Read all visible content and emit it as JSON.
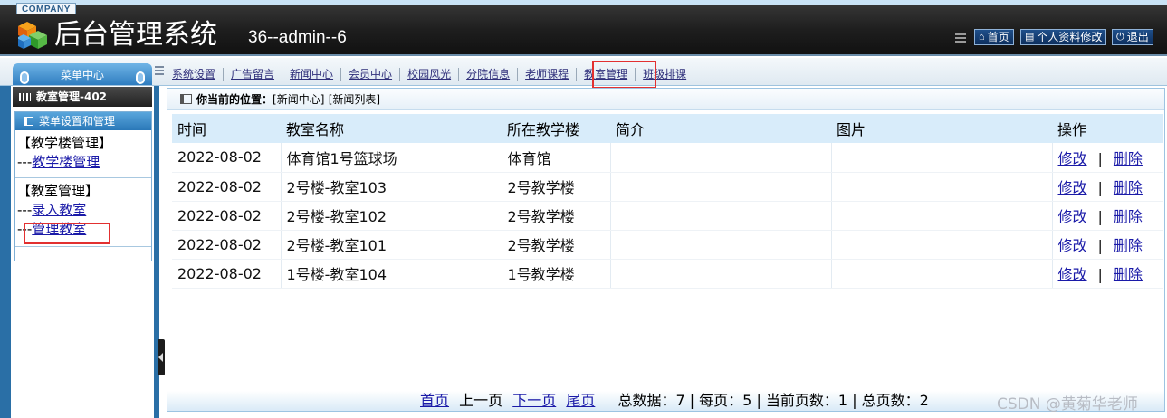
{
  "header": {
    "company": "COMPANY",
    "title": "后台管理系统",
    "user": "36--admin--6",
    "buttons": {
      "home": "首页",
      "profile": "个人资料修改",
      "logout": "退出"
    }
  },
  "menu_center": "菜单中心",
  "tabs": [
    "系统设置",
    "广告留言",
    "新闻中心",
    "会员中心",
    "校园风光",
    "分院信息",
    "老师课程",
    "教室管理",
    "班级排课"
  ],
  "sidebar": {
    "section": "教室管理-402",
    "menu_title": "菜单设置和管理",
    "groups": [
      {
        "title": "【教学楼管理】",
        "items": [
          {
            "prefix": "---",
            "label": "教学楼管理"
          }
        ]
      },
      {
        "title": "【教室管理】",
        "items": [
          {
            "prefix": "---",
            "label": "录入教室"
          },
          {
            "prefix": "---",
            "label": "管理教室"
          }
        ]
      }
    ]
  },
  "breadcrumb": {
    "label": "你当前的位置：",
    "path": "[新闻中心]-[新闻列表]"
  },
  "table": {
    "headers": [
      "时间",
      "教室名称",
      "所在教学楼",
      "简介",
      "图片",
      "操作"
    ],
    "rows": [
      [
        "2022-08-02",
        "体育馆1号篮球场",
        "体育馆",
        "",
        ""
      ],
      [
        "2022-08-02",
        "2号楼-教室103",
        "2号教学楼",
        "",
        ""
      ],
      [
        "2022-08-02",
        "2号楼-教室102",
        "2号教学楼",
        "",
        ""
      ],
      [
        "2022-08-02",
        "2号楼-教室101",
        "2号教学楼",
        "",
        ""
      ],
      [
        "2022-08-02",
        "1号楼-教室104",
        "1号教学楼",
        "",
        ""
      ]
    ],
    "edit_label": "修改",
    "separator": "|",
    "delete_label": "删除"
  },
  "pager": {
    "first": "首页",
    "prev": "上一页",
    "next": "下一页",
    "last": "尾页",
    "stats": "总数据：7 | 每页：5 | 当前页数：1 | 总页数：2"
  },
  "watermark": "CSDN @黄菊华老师",
  "colors": {
    "accent": "#2a6fa6",
    "highlight_box": "#e23030",
    "link": "#1a1aa8"
  }
}
